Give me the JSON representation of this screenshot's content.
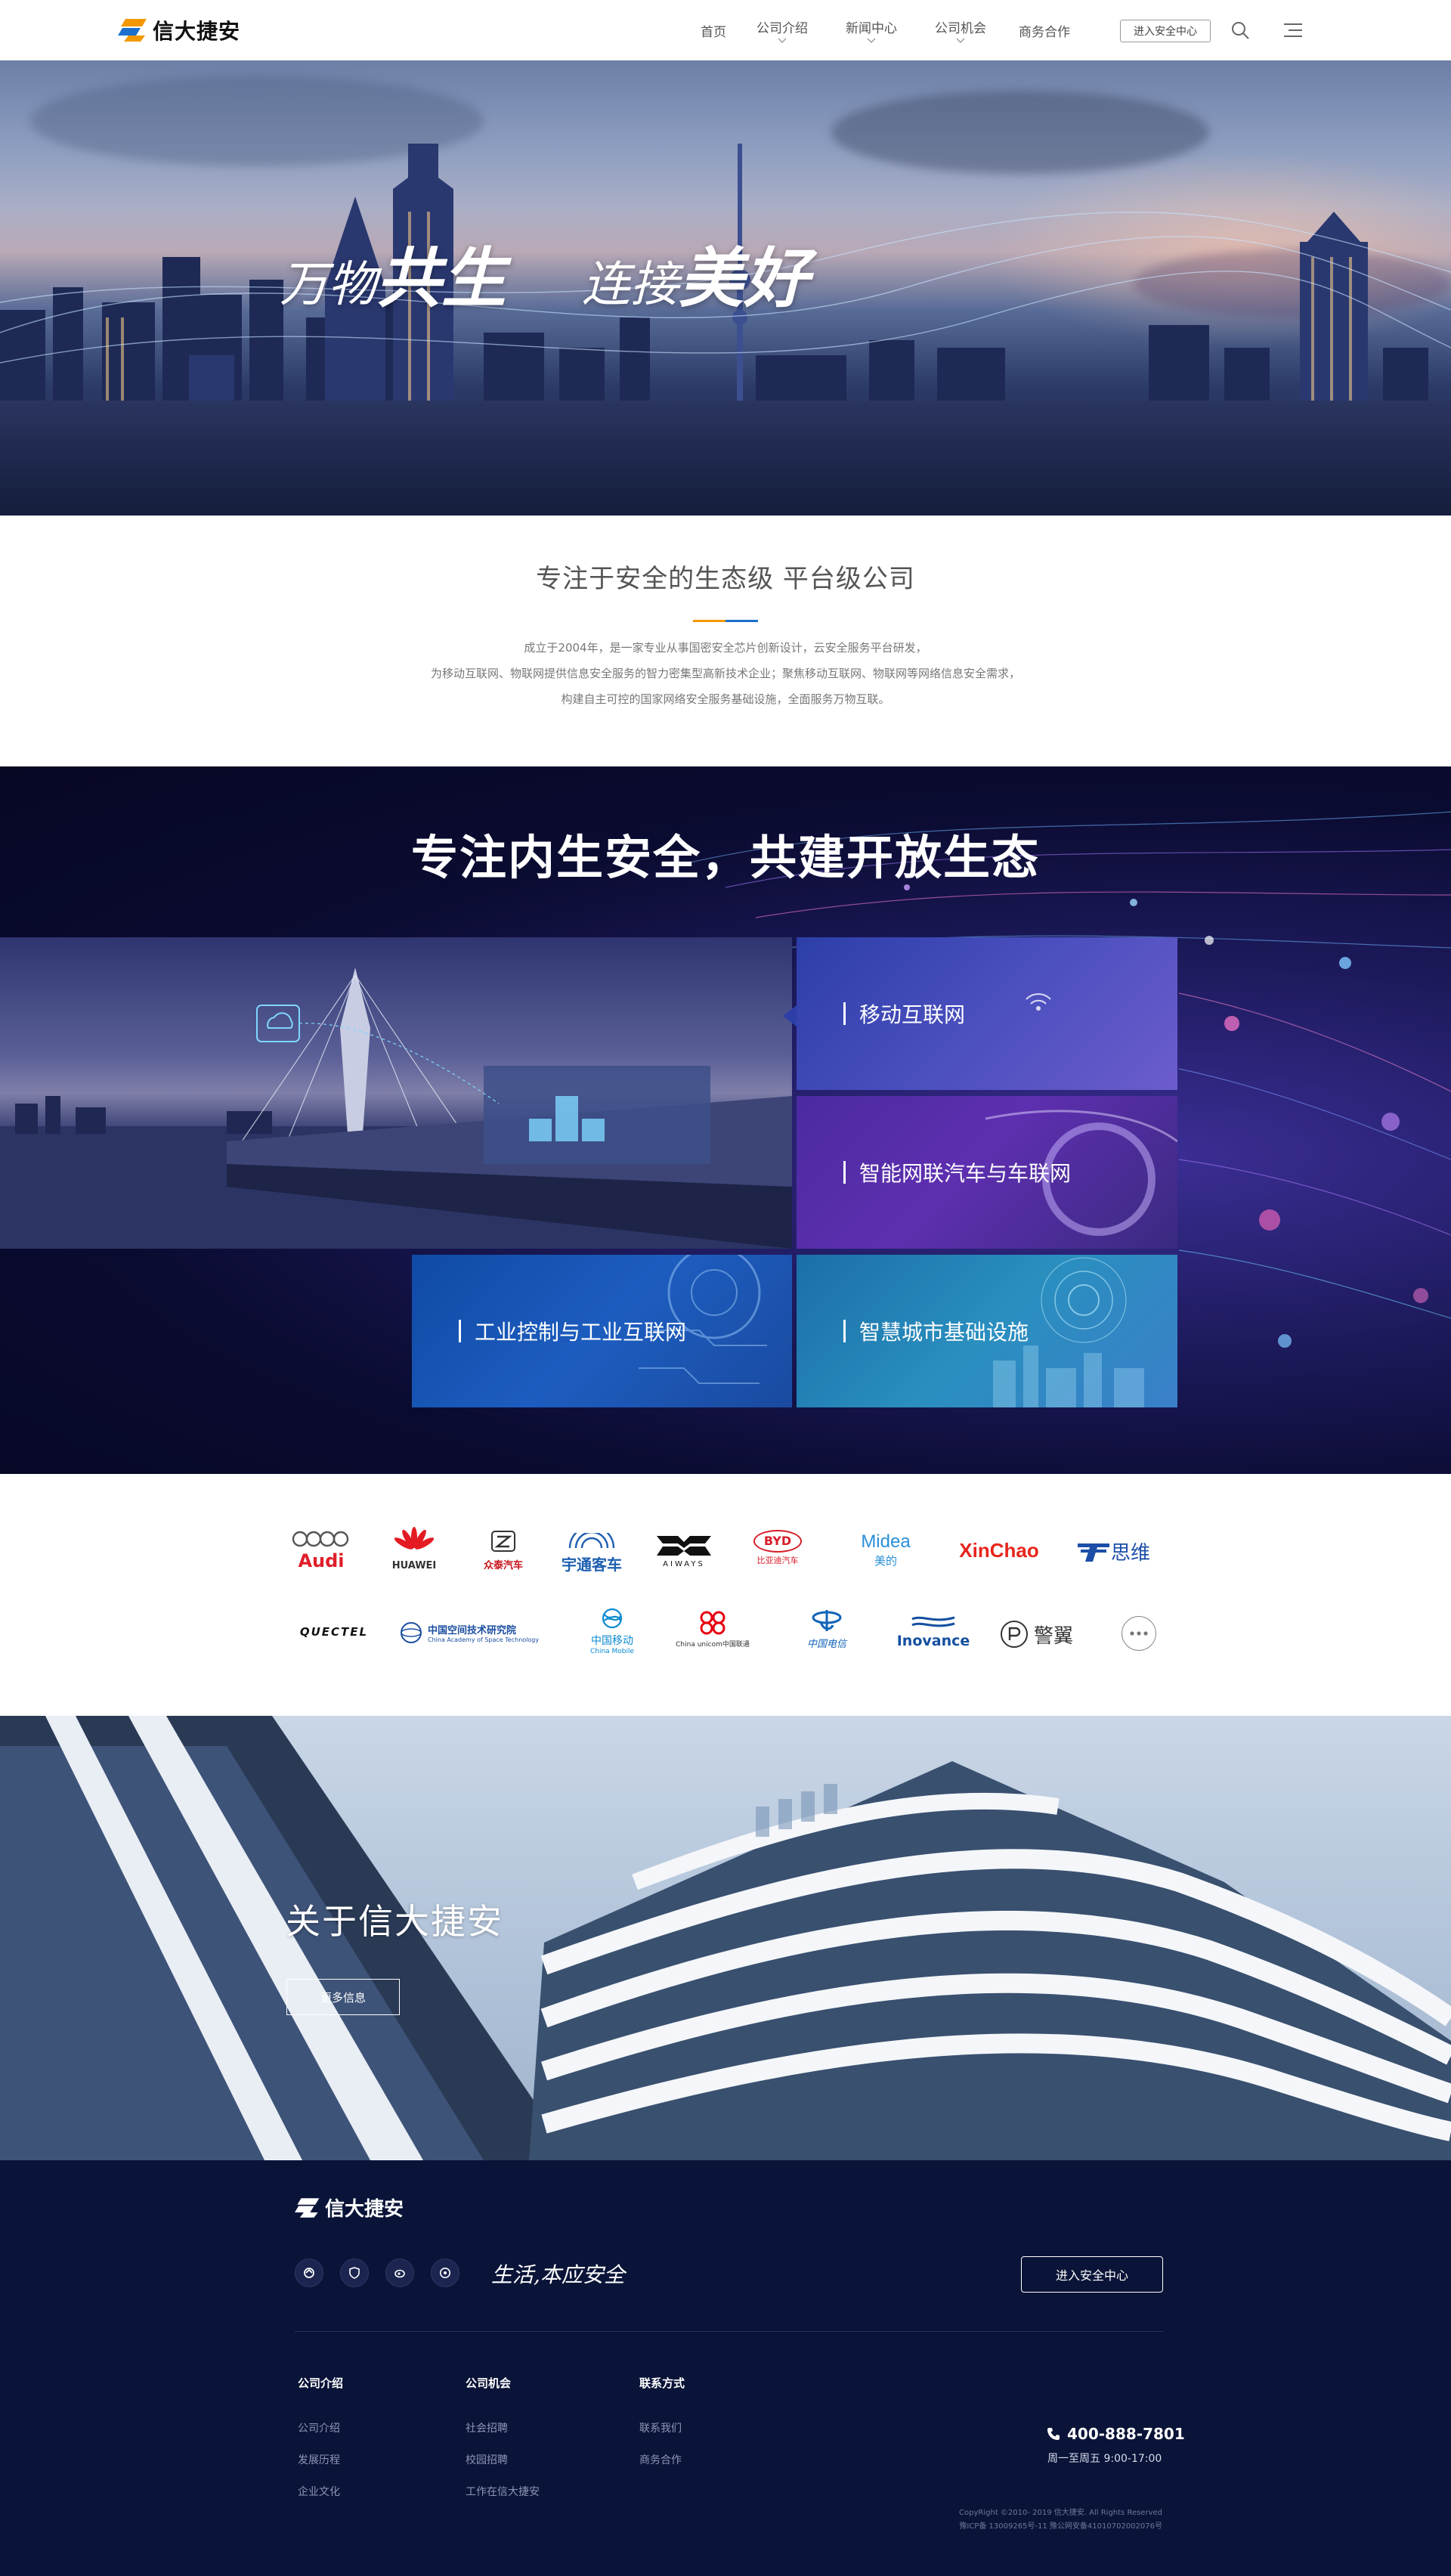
{
  "brand": {
    "name": "信大捷安",
    "colors": {
      "orange": "#f39800",
      "blue": "#1d6fce",
      "navy": "#0a1438"
    }
  },
  "header": {
    "nav": [
      {
        "label": "首页"
      },
      {
        "label": "公司介绍"
      },
      {
        "label": "新闻中心"
      },
      {
        "label": "公司机会"
      },
      {
        "label": "商务合作"
      }
    ],
    "cta_label": "进入安全中心",
    "icons": {
      "search": "search-icon",
      "menu": "menu-icon"
    }
  },
  "hero": {
    "t1a": "万物",
    "t1b": "共生",
    "t2a": "连接",
    "t2b": "美好",
    "slides": 3,
    "active_slide": 1
  },
  "intro": {
    "title": "专注于安全的生态级 平台级公司",
    "lines": [
      "成立于2004年，是一家专业从事国密安全芯片创新设计，云安全服务平台研发，",
      "为移动互联网、物联网提供信息安全服务的智力密集型高新技术企业；聚焦移动互联网、物联网等网络信息安全需求，",
      "构建自主可控的国家网络安全服务基础设施，全面服务万物互联。"
    ]
  },
  "ecosystem": {
    "title": "专注内生安全，共建开放生态",
    "tiles": {
      "mobile": "移动互联网",
      "car": "智能网联汽车与车联网",
      "industrial": "工业控制与工业互联网",
      "city": "智慧城市基础设施"
    }
  },
  "partners": {
    "row1": {
      "audi": "Audi",
      "huawei": "HUAWEI",
      "zotye_cn": "众泰汽车",
      "yutong": "宇通客车",
      "aiways": "AIWAYS",
      "byd": "BYD",
      "byd_cn": "比亚迪汽车",
      "midea": "Midea",
      "midea_cn": "美的",
      "xinchao": "XinChao",
      "tsingsi_cn": "思维"
    },
    "row2": {
      "quectel": "QUECTEL",
      "cast_cn": "中国空间技术研究院",
      "cast_en": "China Academy of Space Technology",
      "cmcc_cn": "中国移动",
      "cmcc_en": "China Mobile",
      "unicom": "China unicom中国联通",
      "telecom_cn": "中国电信",
      "inovance": "Inovance",
      "jingyi_cn": "警翼"
    },
    "more_label": "more-icon"
  },
  "about": {
    "title": "关于信大捷安",
    "button": "更多信息"
  },
  "footer": {
    "brand": "信大捷安",
    "slogan": "生活,本应安全",
    "cta": "进入安全中心",
    "social_icons": [
      "wechat-icon",
      "shield-icon",
      "weibo-icon",
      "sina-icon"
    ],
    "columns": [
      {
        "title": "公司介绍",
        "links": [
          "公司介绍",
          "发展历程",
          "企业文化"
        ]
      },
      {
        "title": "公司机会",
        "links": [
          "社会招聘",
          "校园招聘",
          "工作在信大捷安"
        ]
      },
      {
        "title": "联系方式",
        "links": [
          "联系我们",
          "商务合作"
        ]
      }
    ],
    "phone": "400-888-7801",
    "hours": "周一至周五 9:00-17:00",
    "copyright": "CopyRight ©2010- 2019 信大捷安. All Rights Reserved",
    "icp": "豫ICP备 13009265号-11   豫公网安备41010702002076号"
  }
}
